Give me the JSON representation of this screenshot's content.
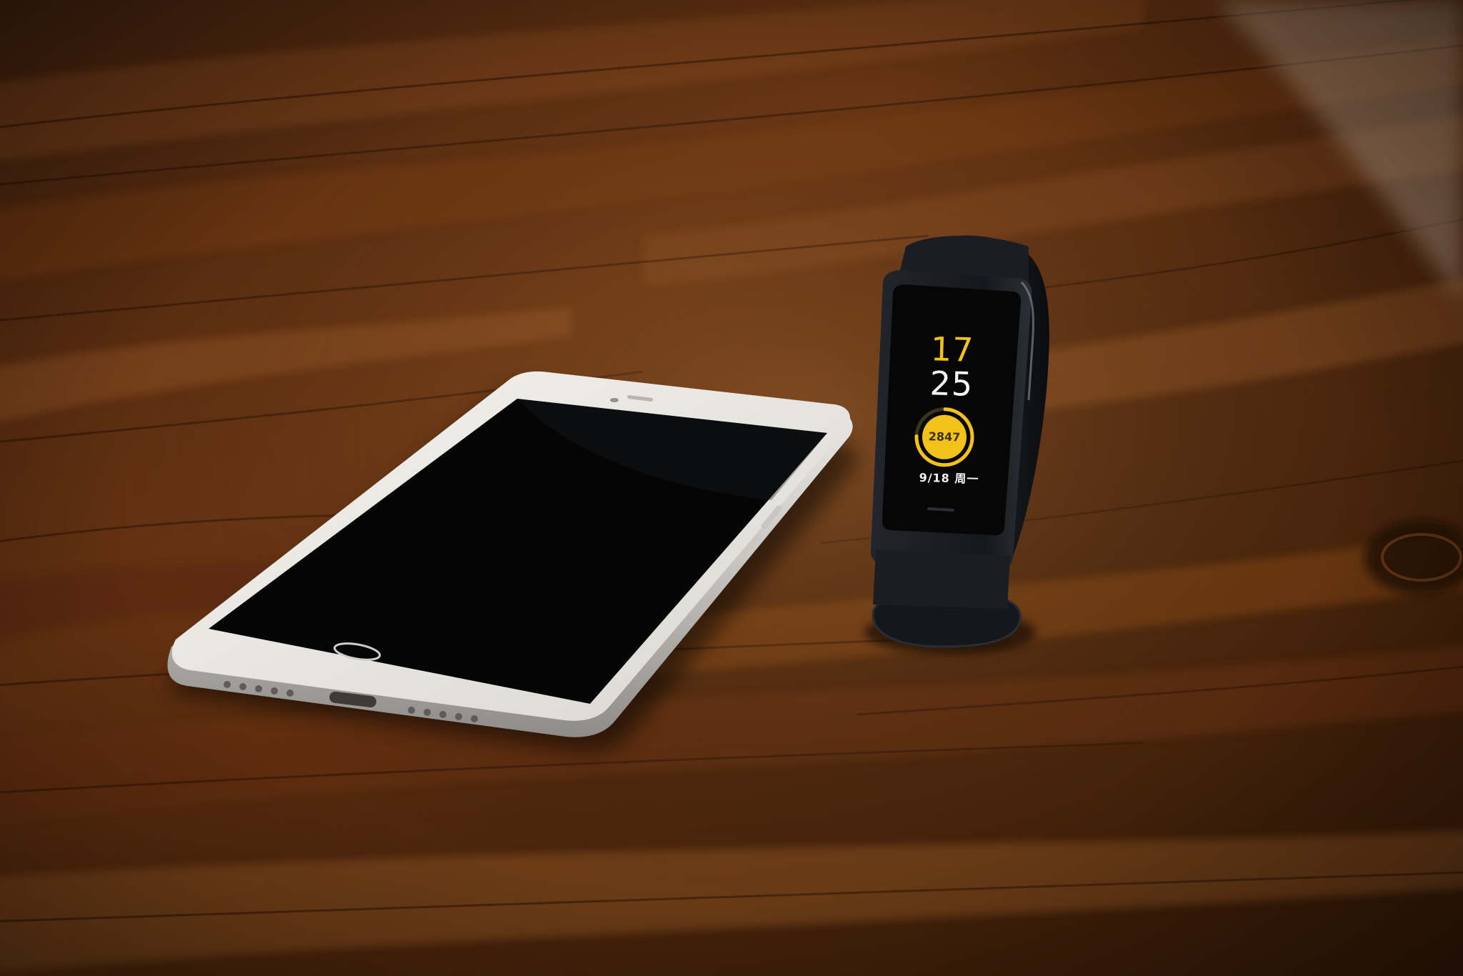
{
  "scene": {
    "description_objects": [
      "smartphone",
      "fitness-band"
    ],
    "colors": {
      "wood_dark": "#2e1608",
      "wood_mid": "#6e3612",
      "wood_light": "#b8753a",
      "phone_body": "#e9e7e2",
      "phone_screen": "#050505",
      "band_body": "#16191e",
      "band_accent": "#f2c21a"
    }
  },
  "band": {
    "hour": "17",
    "minute": "25",
    "steps": "2847",
    "date": "9/18 周一",
    "goal_progress": 0.75
  }
}
